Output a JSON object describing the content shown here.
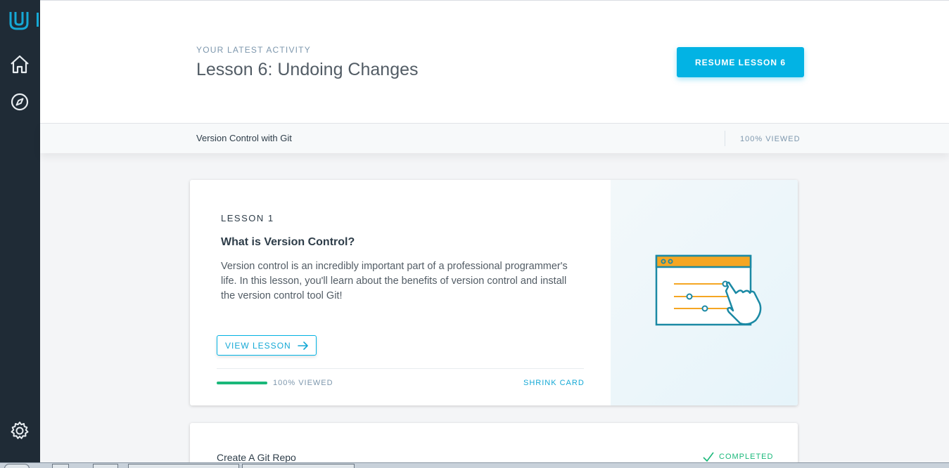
{
  "nav": {
    "logo_icon": "udacity-logo-icon",
    "items": [
      {
        "name": "home-icon"
      },
      {
        "name": "compass-icon"
      },
      {
        "name": "gear-icon"
      }
    ]
  },
  "activity": {
    "eyebrow": "YOUR LATEST ACTIVITY",
    "title": "Lesson 6: Undoing Changes",
    "resume_label": "RESUME LESSON 6"
  },
  "course": {
    "name": "Version Control with Git",
    "viewed": "100% VIEWED"
  },
  "lesson_card": {
    "number_label": "LESSON 1",
    "title": "What is Version Control?",
    "description": "Version control is an incredibly important part of a professional programmer's life. In this lesson, you'll learn about the benefits of version control and install the version control tool Git!",
    "view_label": "VIEW LESSON",
    "progress": 1.0,
    "viewed_label": "100% VIEWED",
    "shrink_label": "SHRINK CARD",
    "art_icon": "browser-slider-click-illustration"
  },
  "next_card": {
    "title": "Create A Git Repo",
    "status": "COMPLETED"
  },
  "colors": {
    "accent": "#02b3e4",
    "nav_bg": "#1f2b36",
    "success": "#1ab87a",
    "art_orange": "#f5a623",
    "art_teal": "#1b89a4"
  }
}
